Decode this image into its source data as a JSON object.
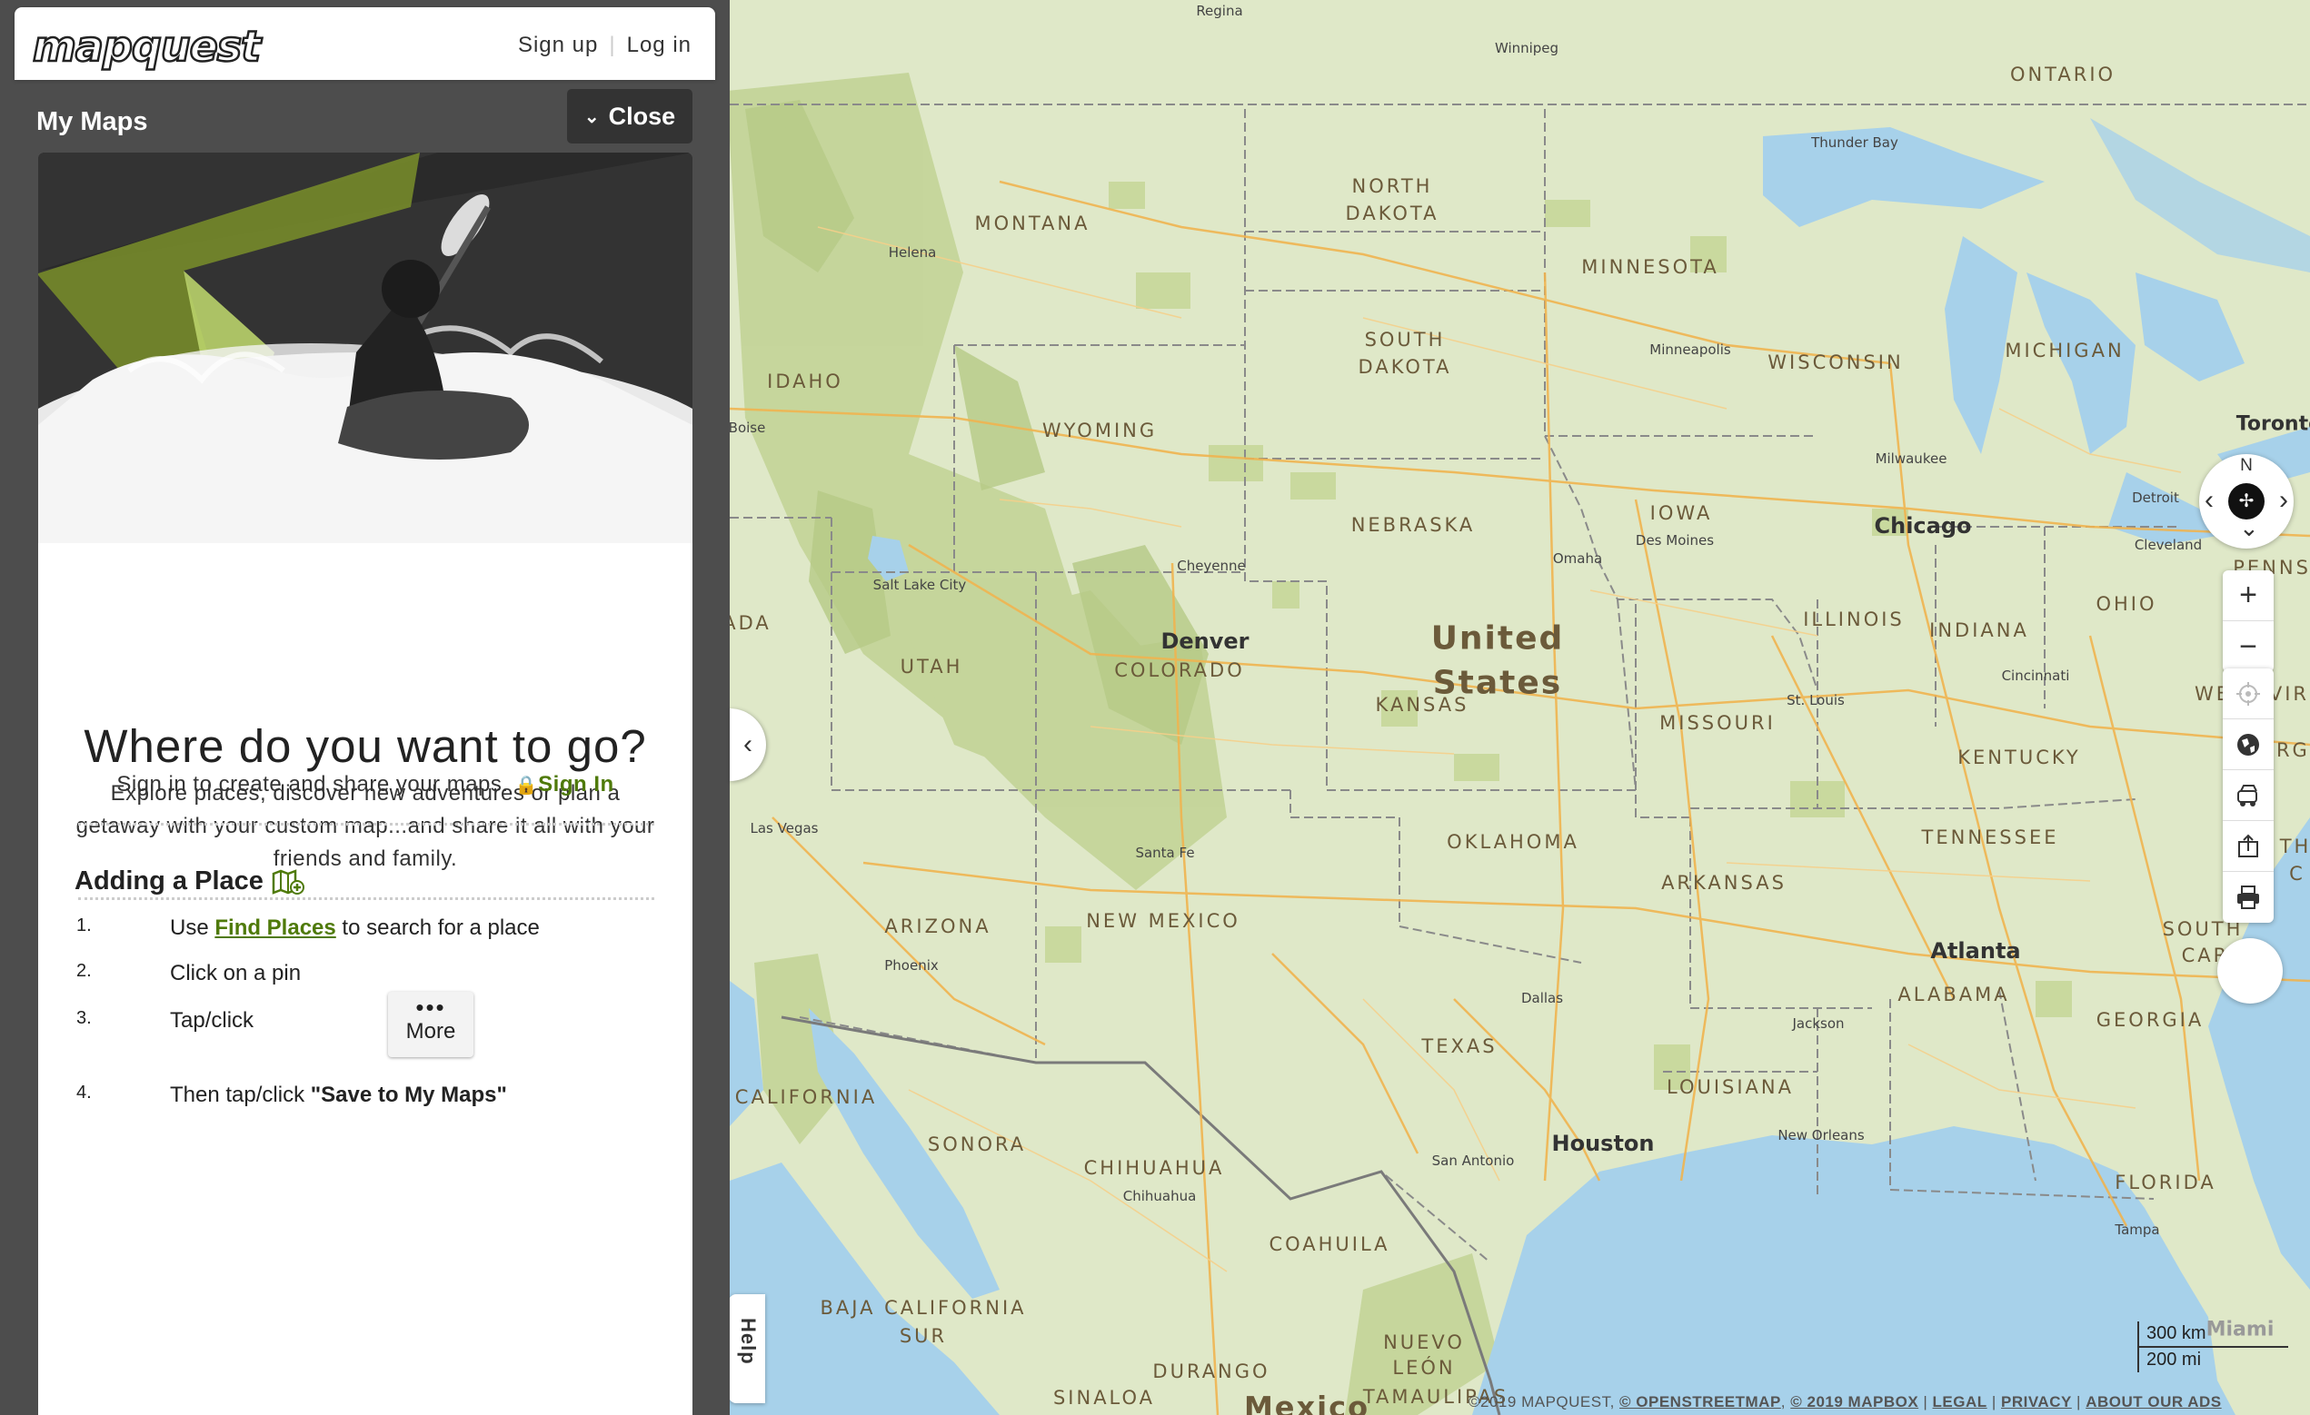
{
  "header": {
    "logo_text": "mapquest",
    "signup_label": "Sign up",
    "login_label": "Log in"
  },
  "panel": {
    "title": "My Maps",
    "close_label": "Close",
    "headline": "Where do you want to go?",
    "subtext": "Explore places, discover new adventures or plan a getaway with your custom map...and share it all with your friends and family.",
    "signin_prompt": "Sign in to create and share your maps.",
    "signin_link": "Sign In",
    "adding_title": "Adding a Place",
    "steps": [
      {
        "num": "1.",
        "before": "Use ",
        "link": "Find Places",
        "after": " to search for a place"
      },
      {
        "num": "2.",
        "text": "Click on a pin"
      },
      {
        "num": "3.",
        "text": "Tap/click",
        "button_dots": "•••",
        "button_label": "More"
      },
      {
        "num": "4.",
        "text_before": "Then tap/click ",
        "text_bold": "\"Save to My Maps\""
      }
    ]
  },
  "map": {
    "states": [
      "ONTARIO",
      "NORTH",
      "DAKOTA",
      "MONTANA",
      "MINNESOTA",
      "SOUTH",
      "DAKOTA",
      "WISCONSIN",
      "MICHIGAN",
      "IDAHO",
      "WYOMING",
      "NEBRASKA",
      "IOWA",
      "ILLINOIS",
      "INDIANA",
      "OHIO",
      "UTAH",
      "COLORADO",
      "KANSAS",
      "MISSOURI",
      "KENTUCKY",
      "TENNESSEE",
      "OKLAHOMA",
      "ARKANSAS",
      "ARIZONA",
      "NEW MEXICO",
      "TEXAS",
      "LOUISIANA",
      "ALABAMA",
      "GEORGIA",
      "FLORIDA",
      "CALIFORNIA",
      "SONORA",
      "CHIHUAHUA",
      "COAHUILA",
      "BAJA CALIFORNIA",
      "SUR",
      "NUEVO",
      "LEÓN",
      "SINALOA",
      "DURANGO",
      "TAMAULIPAS",
      "WEST VIR",
      "SOUTH",
      "CAROL",
      "ADA",
      "PENNSY",
      "RGI",
      "TH",
      "C"
    ],
    "cities": [
      "Regina",
      "Winnipeg",
      "Thunder Bay",
      "Helena",
      "Minneapolis",
      "Boise",
      "Milwaukee",
      "Detroit",
      "Toronto",
      "Des Moines",
      "Omaha",
      "Cleveland",
      "Cheyenne",
      "Salt Lake City",
      "Cincinnati",
      "St. Louis",
      "Las Vegas",
      "Santa Fe",
      "Phoenix",
      "Dallas",
      "Jackson",
      "New Orleans",
      "San Antonio",
      "Tampa",
      "Chihuahua",
      "Miami"
    ],
    "big_cities": [
      "Chicago",
      "Denver",
      "Atlanta",
      "Houston"
    ],
    "country": "United States",
    "country_bottom": "Mexico"
  },
  "controls": {
    "compass_n": "N",
    "zoom_in": "+",
    "zoom_out": "−",
    "scale_km": "300 km",
    "scale_mi": "200 mi",
    "help_label": "Help",
    "collapse_icon": "‹"
  },
  "attribution": {
    "copyright": "©2019 MAPQUEST, ",
    "osm": "© OPENSTREETMAP",
    "mapbox": "© 2019 MAPBOX",
    "legal": "LEGAL",
    "privacy": "PRIVACY",
    "ads": "ABOUT OUR ADS"
  },
  "colors": {
    "land": "#dfe8c8",
    "park": "#c9d99e",
    "mountain": "#b9cc8c",
    "water": "#a7d1ea",
    "border": "#8a8a8a",
    "road": "#f0b450",
    "accent": "#4f7a0a",
    "sidebar": "#4d4d4d"
  }
}
